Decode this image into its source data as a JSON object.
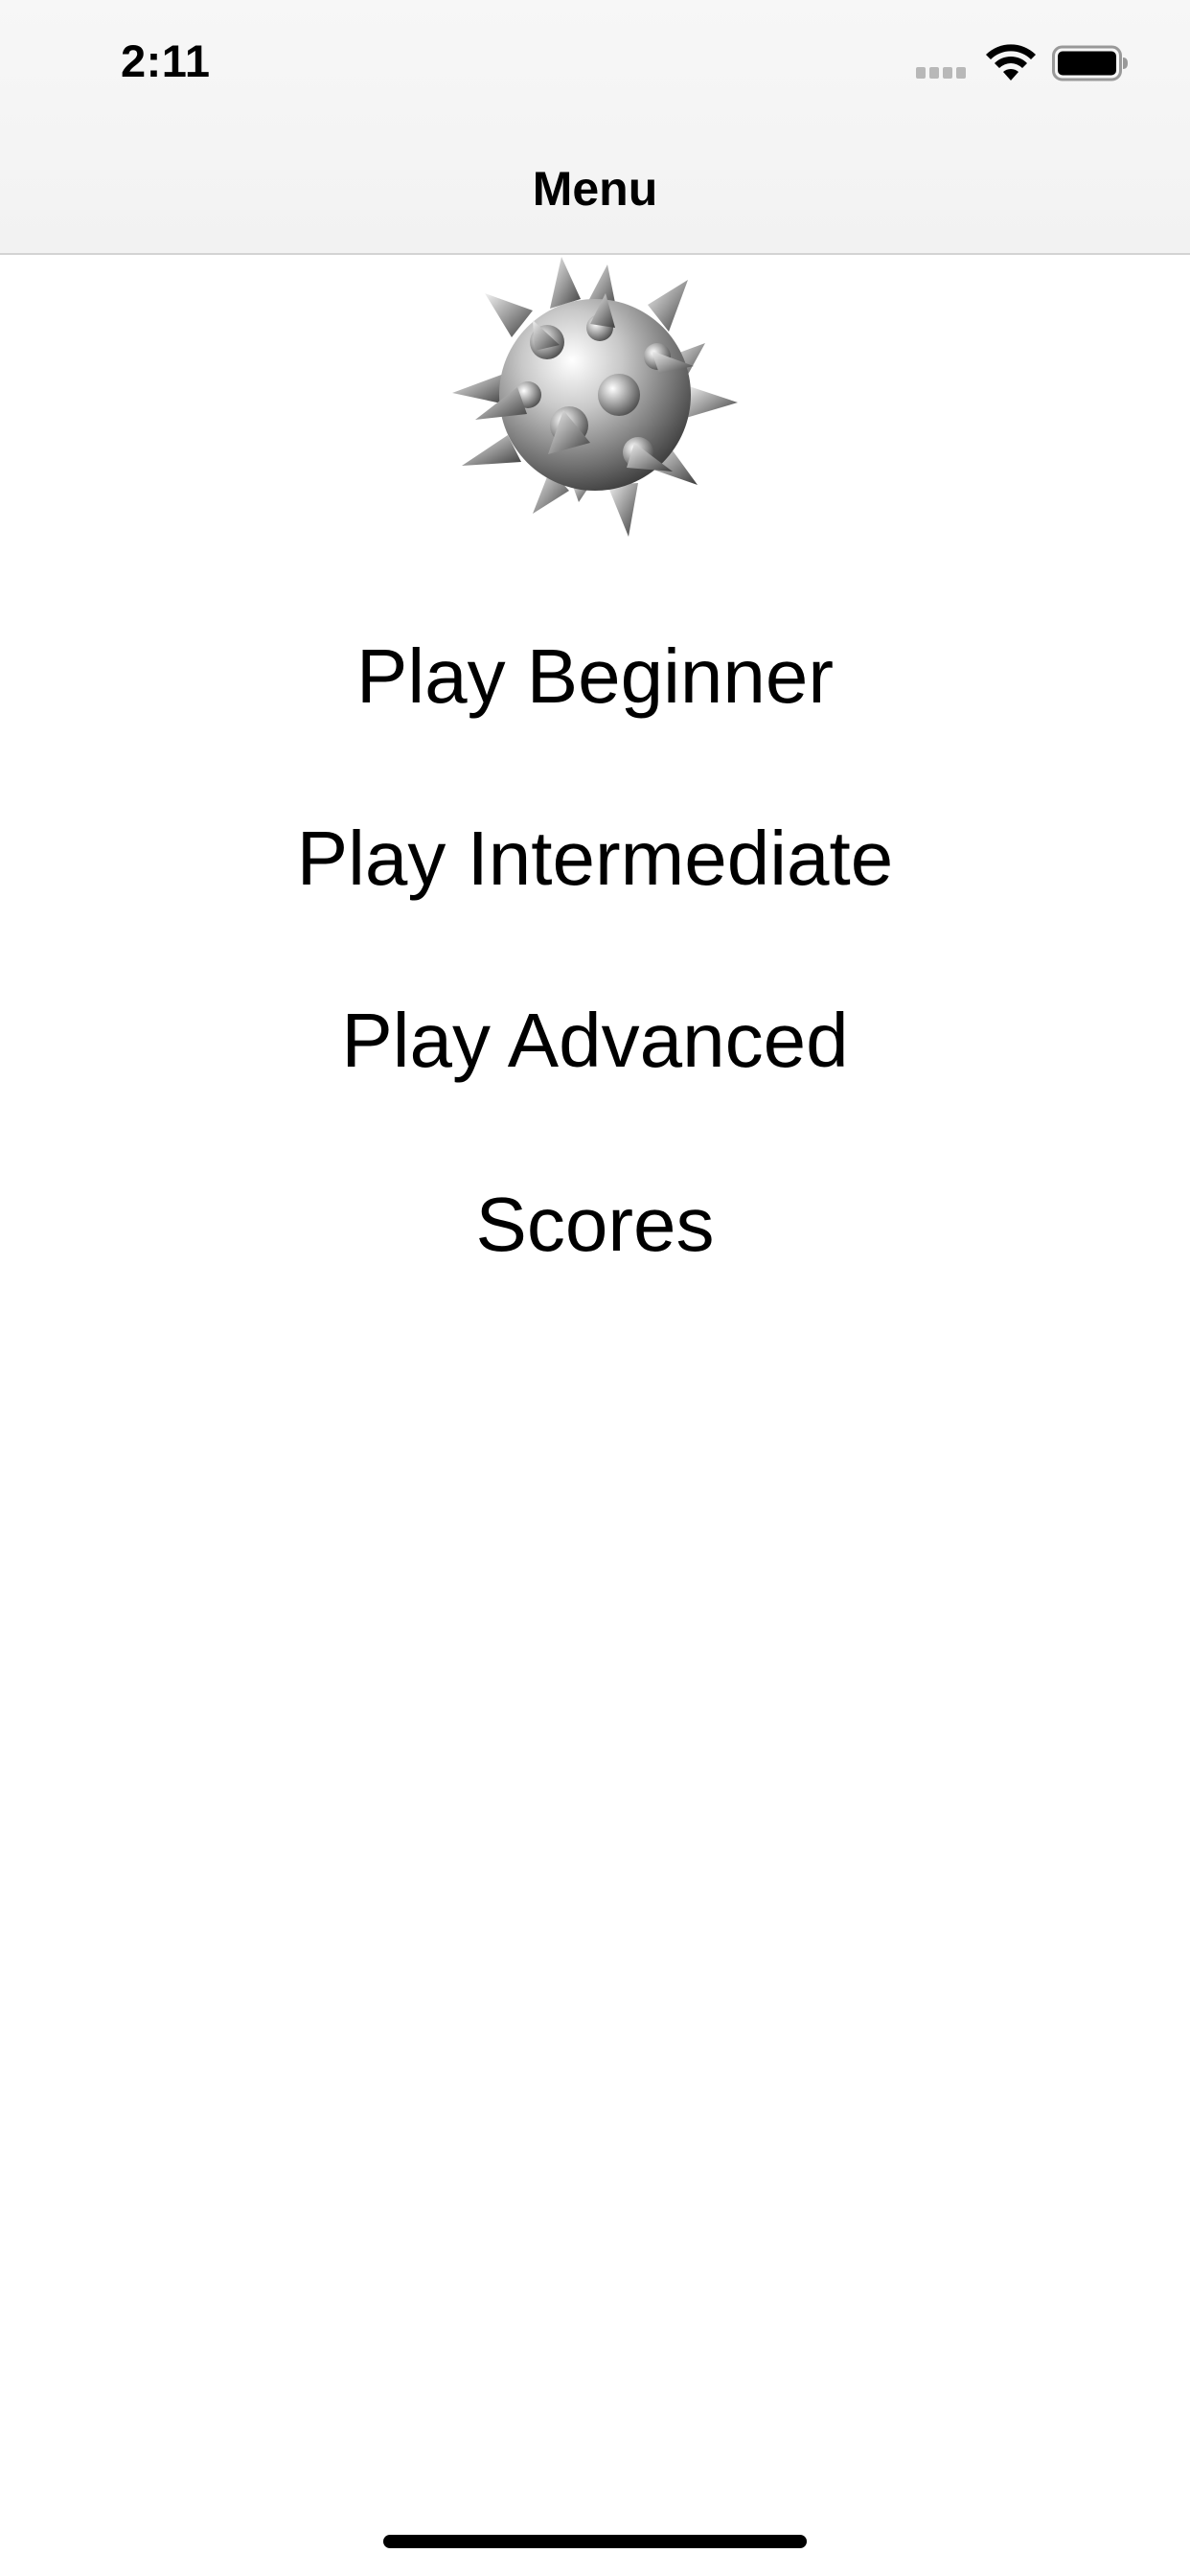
{
  "status_bar": {
    "time": "2:11",
    "signal_icon": "cellular-signal-icon",
    "wifi_icon": "wifi-icon",
    "battery_icon": "battery-icon"
  },
  "nav": {
    "title": "Menu"
  },
  "logo": {
    "icon": "spiked-mine-icon"
  },
  "menu": {
    "items": [
      {
        "label": "Play Beginner"
      },
      {
        "label": "Play Intermediate"
      },
      {
        "label": "Play Advanced"
      },
      {
        "label": "Scores"
      }
    ]
  },
  "colors": {
    "text": "#000000",
    "background": "#ffffff",
    "bar_background": "#f5f5f5",
    "bar_divider": "#d3d3d3"
  }
}
